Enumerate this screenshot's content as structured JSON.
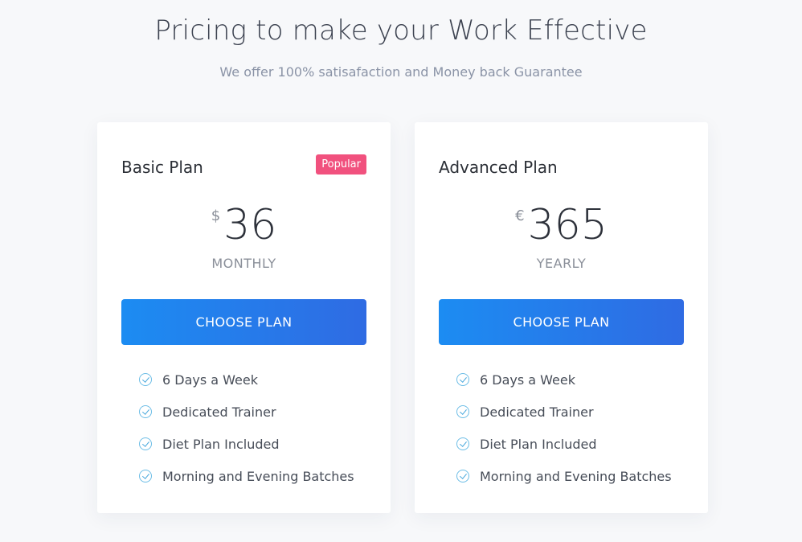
{
  "header": {
    "title": "Pricing to make your Work Effective",
    "subtitle": "We offer 100% satisafaction and Money back Guarantee"
  },
  "plans": [
    {
      "name": "Basic Plan",
      "badge": "Popular",
      "currency": "$",
      "price": "36",
      "period": "MONTHLY",
      "button_label": "CHOOSE PLAN",
      "features": [
        "6 Days a Week",
        "Dedicated Trainer",
        "Diet Plan Included",
        "Morning and Evening Batches"
      ]
    },
    {
      "name": "Advanced Plan",
      "currency": "€",
      "price": "365",
      "period": "YEARLY",
      "button_label": "CHOOSE PLAN",
      "features": [
        "6 Days a Week",
        "Dedicated Trainer",
        "Diet Plan Included",
        "Morning and Evening Batches"
      ]
    }
  ],
  "colors": {
    "background": "#f7f8fa",
    "badge": "#f1517e",
    "button_gradient_start": "#1c8cf2",
    "button_gradient_end": "#2f6be3",
    "check": "#6cbde6"
  },
  "icons": {
    "feature_check": "check-circle-icon"
  }
}
